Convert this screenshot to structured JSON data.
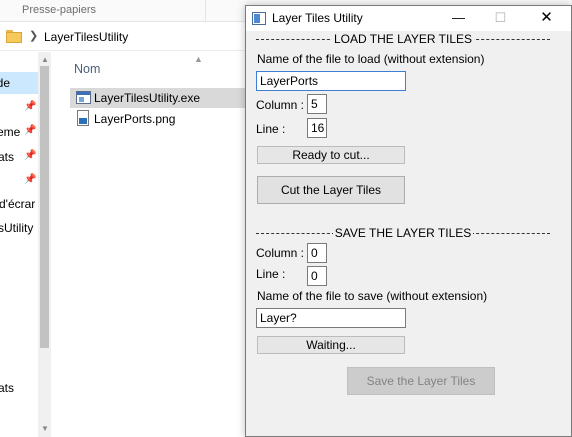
{
  "explorer": {
    "ribbon_label": "Presse-papiers",
    "address_path": "LayerTilesUtility",
    "column_header": "Nom",
    "nav_items": [
      "de",
      "eme",
      "ats",
      "d'écrar",
      "sUtility",
      "ats"
    ],
    "files": [
      {
        "name": "LayerTilesUtility.exe",
        "icon": "exe-file-icon",
        "selected": true
      },
      {
        "name": "LayerPorts.png",
        "icon": "png-file-icon",
        "selected": false
      }
    ]
  },
  "dialog": {
    "title": "Layer Tiles Utility",
    "load_section": {
      "title": "LOAD THE LAYER TILES",
      "filename_label": "Name of the file to load (without extension)",
      "filename_value": "LayerPorts",
      "column_label": "Column :",
      "column_value": "5",
      "line_label": "Line  :",
      "line_value": "16",
      "status": "Ready to cut...",
      "cut_button": "Cut the Layer Tiles"
    },
    "save_section": {
      "title": "SAVE THE LAYER TILES",
      "column_label": "Column :",
      "column_value": "0",
      "line_label": "Line  :",
      "line_value": "0",
      "filename_label": "Name of the file to save (without extension)",
      "filename_value": "Layer?",
      "status": "Waiting...",
      "save_button": "Save the Layer Tiles"
    }
  }
}
